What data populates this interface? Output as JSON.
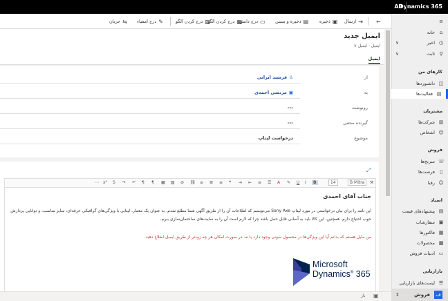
{
  "topbar": {
    "brand": "Dynamics 365",
    "all_label": "All"
  },
  "commands": {
    "send": "ارسال",
    "save": "ذخیره",
    "save_close": "ذخیره و بستن",
    "insert_kb": "درج دانش",
    "insert_template": "درج کردن الگو",
    "insert_signature": "درج امضاء",
    "flow": "جریان"
  },
  "nav": {
    "home": "خانه",
    "recent": "اخیر",
    "pinned": "ثابت",
    "my_work_header": "کارهای من",
    "dashboards": "داشبوردها",
    "activities": "فعالیت‌ها",
    "customers_header": "مشتریان",
    "accounts": "شرکت‌ها",
    "contacts": "اشخاص",
    "sales_header": "فروش",
    "leads": "سرنخ‌ها",
    "opportunities": "فرصت‌ها",
    "competitors": "رقبا",
    "collateral_header": "اسناد",
    "quotes": "پیشنهادهای قیمت",
    "orders": "سفارشات",
    "invoices": "فاکتورها",
    "products": "محصولات",
    "sales_literature": "ادبیات فروش",
    "marketing_header": "بازاریابی",
    "marketing_lists": "لیست‌های بازاریابی",
    "area": "فروش",
    "area_badge": "ف"
  },
  "header": {
    "title": "ایمیل جدید",
    "entity": "ایمیل",
    "tab": "ایمیل"
  },
  "form": {
    "from_label": "از",
    "from_value": "فرشید ایرانی",
    "to_label": "به",
    "to_value": "مرتضی احمدی",
    "cc_label": "رونوشت",
    "cc_value": "---",
    "bcc_label": "گیرنده مخفی",
    "bcc_value": "---",
    "subject_label": "موضوع",
    "subject_value": "درخواست لپتاپ"
  },
  "editor": {
    "font": "B Mitra",
    "size": "14",
    "greeting": "جناب آقای احمدی",
    "paragraph1": "این نامه را برای بیان درخواستی در مورد لپتاپ Sony Axe می‌نویسم که اطلاعات آن را از طریق آگهی شما مطلع شدم. به عنوان یک معمار، لپتاپی با ویژگی‌های گرافیکی حرفه‌ای، سایز مناسب، و توانایی پردازش خوب احتیاج دارم. همچنین، این کالا باید به آسانی قابل حمل باشد چرا که لازم است آن را به سایت‌های ساختمان‌سازی ببرم.",
    "paragraph2": "من مایل هستم که بدانم آیا این ویژگی‌ها در محصول سونی وجود دارد یا نه. در صورت امکان هر چه زودتر از طریق ایمیل اطلاع دهید.",
    "logo_line1": "Microsoft",
    "logo_line2": "Dynamics",
    "logo_num": "365"
  },
  "footer": {
    "status": "باز"
  },
  "colors": {
    "accent": "#2266e3",
    "topbar": "#000000",
    "red_text": "#d13438",
    "logo_purple": "#002050"
  }
}
